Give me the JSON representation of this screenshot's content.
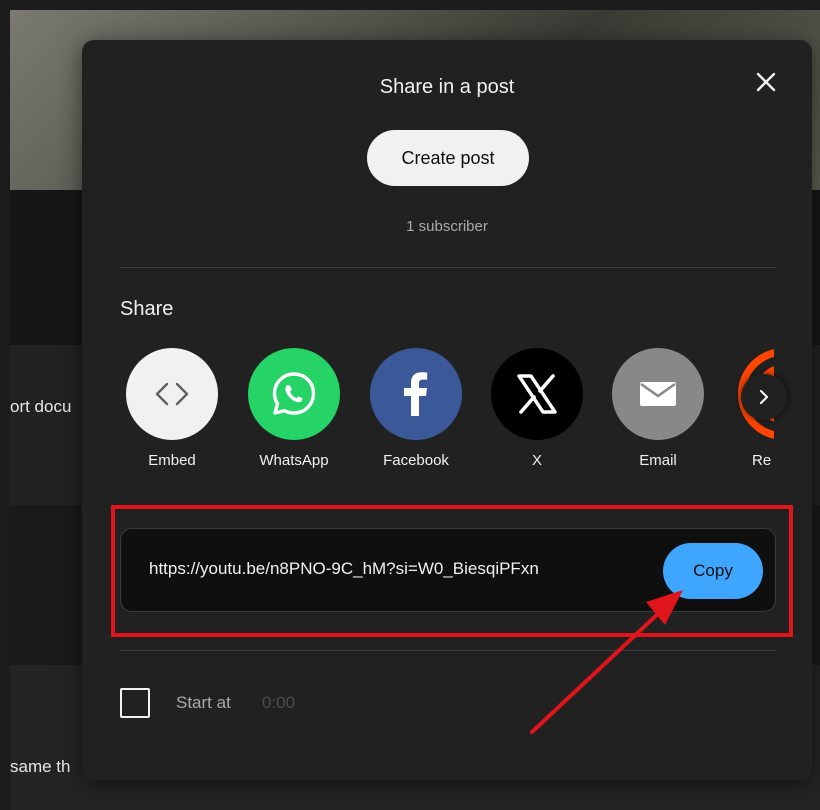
{
  "background": {
    "snippet_1": "ort docu",
    "snippet_2": "same th"
  },
  "modal": {
    "title": "Share in a post",
    "close_icon": "close-icon",
    "create_post_label": "Create post",
    "subscriber_text": "1 subscriber",
    "share_heading": "Share",
    "share_options": [
      {
        "label": "Embed",
        "icon": "embed-icon",
        "color": "#f1f1f1"
      },
      {
        "label": "WhatsApp",
        "icon": "whatsapp-icon",
        "color": "#25d366"
      },
      {
        "label": "Facebook",
        "icon": "facebook-icon",
        "color": "#3b5998"
      },
      {
        "label": "X",
        "icon": "x-icon",
        "color": "#000000"
      },
      {
        "label": "Email",
        "icon": "email-icon",
        "color": "#888888"
      },
      {
        "label": "Re",
        "icon": "reddit-icon",
        "color": "#ff4500"
      }
    ],
    "next_icon": "chevron-right-icon",
    "url": "https://youtu.be/n8PNO-9C_hM?si=W0_BiesqiPFxn",
    "copy_label": "Copy",
    "start_at_label": "Start at",
    "start_at_time": "0:00",
    "start_at_checked": false
  },
  "annotation": {
    "highlight_color": "#e0141b",
    "arrow_color": "#e0141b"
  },
  "colors": {
    "modal_bg": "#212121",
    "accent": "#3ea6ff",
    "url_box_bg": "#0f0f0f"
  }
}
